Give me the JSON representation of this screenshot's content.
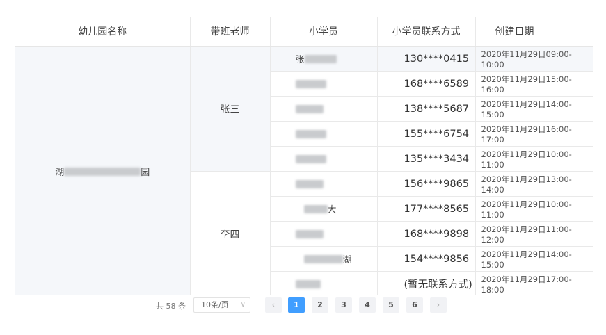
{
  "table": {
    "headers": [
      "幼儿园名称",
      "带班老师",
      "小学员",
      "小学员联系方式",
      "创建日期"
    ],
    "kindergarten": {
      "prefix": "湖",
      "suffix": "园"
    },
    "teachers": [
      "张三",
      "李四"
    ],
    "rows": [
      {
        "student_pre": "张",
        "student_suf": "",
        "phone": "130****0415",
        "date": "2020年11月29日09:00-10:00"
      },
      {
        "student_pre": "",
        "student_suf": "",
        "phone": "168****6589",
        "date": "2020年11月29日15:00-16:00"
      },
      {
        "student_pre": "",
        "student_suf": "",
        "phone": "138****5687",
        "date": "2020年11月29日14:00-15:00"
      },
      {
        "student_pre": "",
        "student_suf": "",
        "phone": "155****6754",
        "date": "2020年11月29日16:00-17:00"
      },
      {
        "student_pre": "",
        "student_suf": "",
        "phone": "135****3434",
        "date": "2020年11月29日10:00-11:00"
      },
      {
        "student_pre": "",
        "student_suf": "",
        "phone": "156****9865",
        "date": "2020年11月29日13:00-14:00"
      },
      {
        "student_pre": "",
        "student_suf": "大",
        "phone": "177****8565",
        "date": "2020年11月29日10:00-11:00"
      },
      {
        "student_pre": "",
        "student_suf": "",
        "phone": "168****9898",
        "date": "2020年11月29日11:00-12:00"
      },
      {
        "student_pre": "",
        "student_suf": "湖",
        "phone": "154****9856",
        "date": "2020年11月29日14:00-15:00"
      },
      {
        "student_pre": "",
        "student_suf": "",
        "phone": "(暂无联系方式)",
        "date": "2020年11月29日17:00-18:00"
      }
    ]
  },
  "pagination": {
    "total": "共 58 条",
    "page_size": "10条/页",
    "prev": "‹",
    "next": "›",
    "pages": [
      "1",
      "2",
      "3",
      "4",
      "5",
      "6"
    ],
    "current": "1"
  }
}
